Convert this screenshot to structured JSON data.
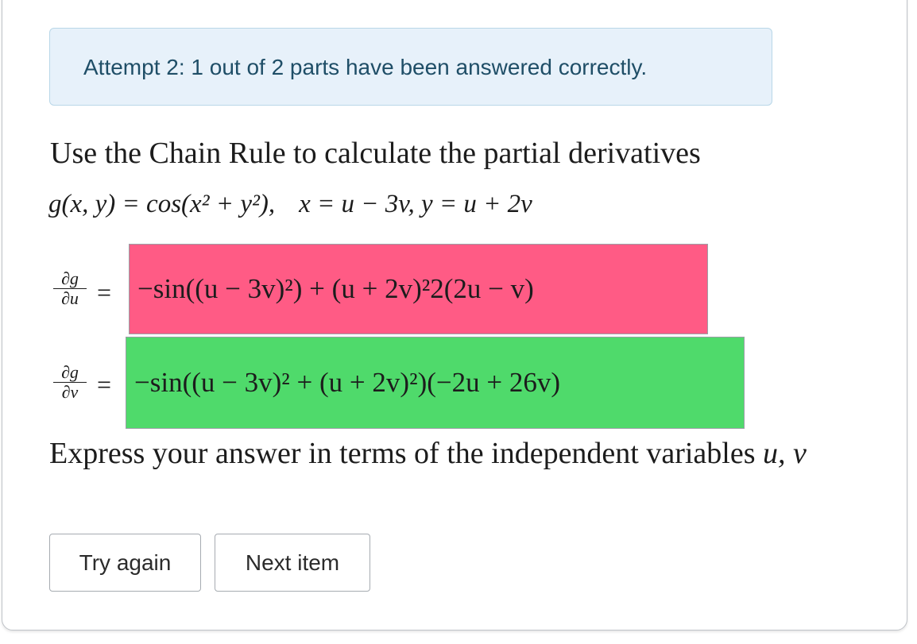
{
  "status_alert": {
    "text": "Attempt 2: 1 out of 2 parts have been answered correctly."
  },
  "question": {
    "prompt": "Use the Chain Rule to calculate the partial derivatives",
    "function_def": "g(x, y) = cos(x² + y²),",
    "substitution": "x = u − 3v, y = u + 2v",
    "instruction_prefix": "Express your answer in terms of the independent variables",
    "instruction_vars": "u, v"
  },
  "parts": [
    {
      "label_num": "∂g",
      "label_den": "∂u",
      "equals": "=",
      "answer": "−sin((u − 3v)²) + (u + 2v)²2(2u − v)",
      "status": "incorrect",
      "status_color": "#ff5b85"
    },
    {
      "label_num": "∂g",
      "label_den": "∂v",
      "equals": "=",
      "answer": "−sin((u − 3v)² + (u + 2v)²)(−2u + 26v)",
      "status": "correct",
      "status_color": "#4fda6b"
    }
  ],
  "buttons": {
    "try_again": "Try again",
    "next_item": "Next item"
  },
  "colors": {
    "alert_background": "#e7f1fa",
    "alert_text": "#1f4e67"
  }
}
